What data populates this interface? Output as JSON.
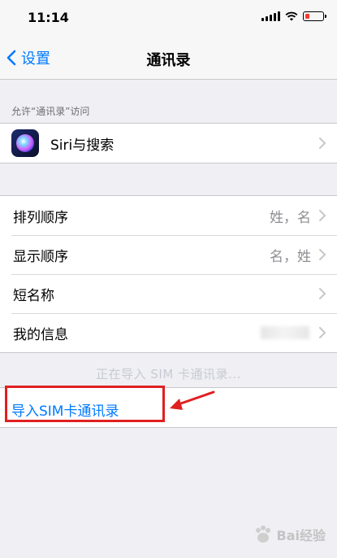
{
  "status_bar": {
    "time": "11:14",
    "battery_color": "#ff3b30",
    "battery_level": 0.2
  },
  "nav": {
    "back_label": "设置",
    "title": "通讯录"
  },
  "section_header": "允许“通讯录”访问",
  "siri_row": {
    "label": "Siri与搜索",
    "icon": "siri-icon"
  },
  "settings_rows": [
    {
      "label": "排列顺序",
      "value": "姓，名"
    },
    {
      "label": "显示顺序",
      "value": "名，姓"
    },
    {
      "label": "短名称",
      "value": ""
    },
    {
      "label": "我的信息",
      "value": ""
    }
  ],
  "status_message": "正在导入 SIM 卡通讯录...",
  "import_action": "导入SIM卡通讯录",
  "watermark": "Bai经验",
  "accent_color": "#007aff",
  "annotation_color": "#e02020"
}
